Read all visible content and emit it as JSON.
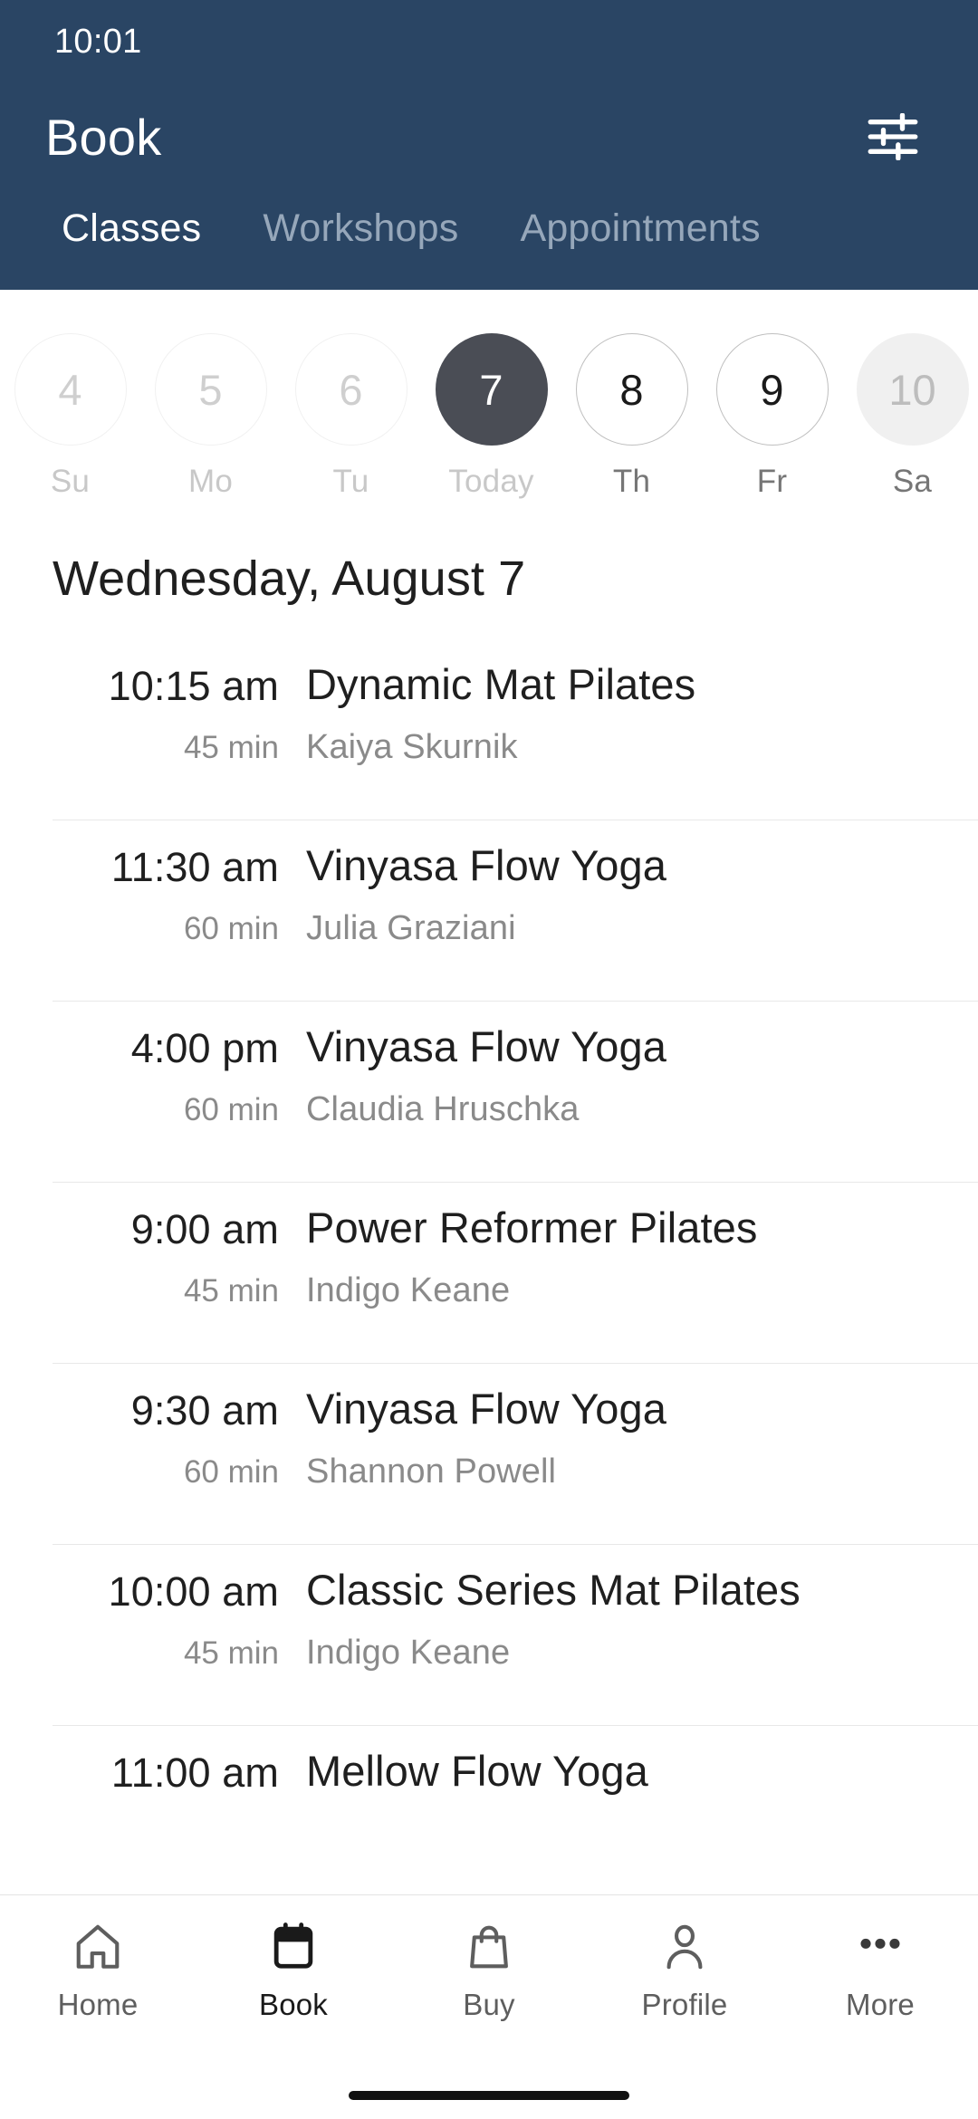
{
  "status_bar": {
    "time": "10:01"
  },
  "header": {
    "title": "Book",
    "filter_icon": "sliders-icon",
    "accent_bg": "#2A4564",
    "tabs": [
      {
        "label": "Classes",
        "active": true
      },
      {
        "label": "Workshops",
        "active": false
      },
      {
        "label": "Appointments",
        "active": false
      }
    ]
  },
  "date_strip": {
    "selected_color": "#4A4D55",
    "dates": [
      {
        "day": "4",
        "label": "Su",
        "state": "disabled"
      },
      {
        "day": "5",
        "label": "Mo",
        "state": "disabled"
      },
      {
        "day": "6",
        "label": "Tu",
        "state": "disabled"
      },
      {
        "day": "7",
        "label": "Today",
        "state": "selected"
      },
      {
        "day": "8",
        "label": "Th",
        "state": "enabled"
      },
      {
        "day": "9",
        "label": "Fr",
        "state": "enabled"
      },
      {
        "day": "10",
        "label": "Sa",
        "state": "filled"
      }
    ]
  },
  "schedule": {
    "day_heading": "Wednesday, August 7",
    "classes": [
      {
        "time": "10:15 am",
        "duration": "45 min",
        "name": "Dynamic Mat Pilates",
        "teacher": "Kaiya Skurnik"
      },
      {
        "time": "11:30 am",
        "duration": "60 min",
        "name": "Vinyasa Flow Yoga",
        "teacher": "Julia Graziani"
      },
      {
        "time": "4:00 pm",
        "duration": "60 min",
        "name": "Vinyasa Flow Yoga",
        "teacher": "Claudia Hruschka"
      },
      {
        "time": "9:00 am",
        "duration": "45 min",
        "name": "Power Reformer Pilates",
        "teacher": "Indigo Keane"
      },
      {
        "time": "9:30 am",
        "duration": "60 min",
        "name": "Vinyasa Flow Yoga",
        "teacher": "Shannon Powell"
      },
      {
        "time": "10:00 am",
        "duration": "45 min",
        "name": "Classic Series Mat Pilates",
        "teacher": "Indigo Keane"
      },
      {
        "time": "11:00 am",
        "duration": "",
        "name": "Mellow Flow Yoga",
        "teacher": ""
      }
    ]
  },
  "bottom_nav": {
    "items": [
      {
        "label": "Home",
        "icon": "home-icon",
        "active": false
      },
      {
        "label": "Book",
        "icon": "calendar-icon",
        "active": true
      },
      {
        "label": "Buy",
        "icon": "bag-icon",
        "active": false
      },
      {
        "label": "Profile",
        "icon": "person-icon",
        "active": false
      },
      {
        "label": "More",
        "icon": "ellipsis-icon",
        "active": false
      }
    ]
  }
}
